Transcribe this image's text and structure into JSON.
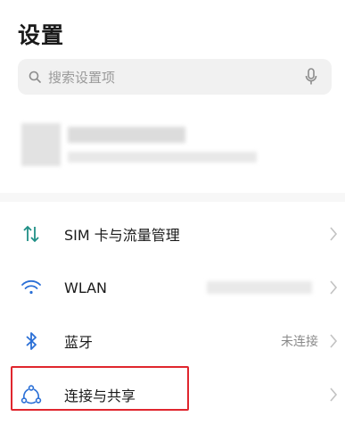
{
  "header": {
    "title": "设置"
  },
  "search": {
    "placeholder": "搜索设置项",
    "icon": "search-icon",
    "voice_icon": "mic-icon"
  },
  "settings": {
    "items": [
      {
        "label": "SIM 卡与流量管理",
        "icon": "sim-data-arrows-icon",
        "value": ""
      },
      {
        "label": "WLAN",
        "icon": "wifi-icon",
        "value": ""
      },
      {
        "label": "蓝牙",
        "icon": "bluetooth-icon",
        "value": "未连接"
      },
      {
        "label": "连接与共享",
        "icon": "connection-sharing-icon",
        "value": ""
      }
    ]
  },
  "colors": {
    "accent_teal": "#1f8f86",
    "accent_blue": "#2a6fd6",
    "highlight_red": "#e0262e"
  }
}
